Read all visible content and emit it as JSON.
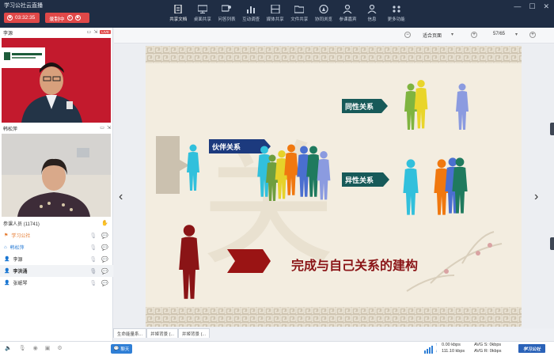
{
  "app": {
    "title": "学习公社云直播"
  },
  "top": {
    "timer": "03:32:35",
    "recording": "录制中",
    "tools": [
      {
        "label": "共享文档",
        "icon": "document-icon",
        "active": true
      },
      {
        "label": "桌面共享",
        "icon": "monitor-icon"
      },
      {
        "label": "问答列表",
        "icon": "qa-icon"
      },
      {
        "label": "互动调查",
        "icon": "chart-icon"
      },
      {
        "label": "媒体共享",
        "icon": "film-icon"
      },
      {
        "label": "文件共享",
        "icon": "folder-icon"
      },
      {
        "label": "协同浏览",
        "icon": "compass-icon"
      },
      {
        "label": "参课嘉宾",
        "icon": "guest-icon"
      },
      {
        "label": "信息",
        "icon": "info-icon"
      },
      {
        "label": "更多功能",
        "icon": "more-icon"
      }
    ]
  },
  "videos": [
    {
      "name": "李源",
      "live": "LIVE"
    },
    {
      "name": "韩松萍"
    }
  ],
  "participants": {
    "header": "参课人员 (11741)",
    "rows": [
      {
        "name": "学习公社",
        "color": "orange",
        "icon": "host-icon"
      },
      {
        "name": "韩松萍",
        "color": "blue",
        "icon": "presenter-icon"
      },
      {
        "name": "李源",
        "color": "",
        "icon": "user-icon"
      },
      {
        "name": "李洪涌",
        "color": "",
        "icon": "user-icon",
        "selected": true
      },
      {
        "name": "张岷琴",
        "color": "",
        "icon": "user-icon"
      }
    ]
  },
  "docbar": {
    "zoom": "适合页面",
    "page": "57/65"
  },
  "doctabs": [
    "生命能量系...",
    "并姬背景 (...",
    "并姬背景 (..."
  ],
  "slide": {
    "partner": "伙伴关系",
    "same_sex": "同性关系",
    "opposite_sex": "异性关系",
    "caption": "完成与自己关系的建构"
  },
  "bottom": {
    "chat": "聊天",
    "net_up": "0.00 kbps",
    "net_down": "111.10 kbps",
    "avg_s": "AVG S: 0kbps",
    "avg_r": "AVG R: 0kbps",
    "brand": "学习公社"
  },
  "colors": {
    "topbar": "#1f2d44",
    "accent": "#e04848",
    "arrow": "#1f4e63"
  }
}
